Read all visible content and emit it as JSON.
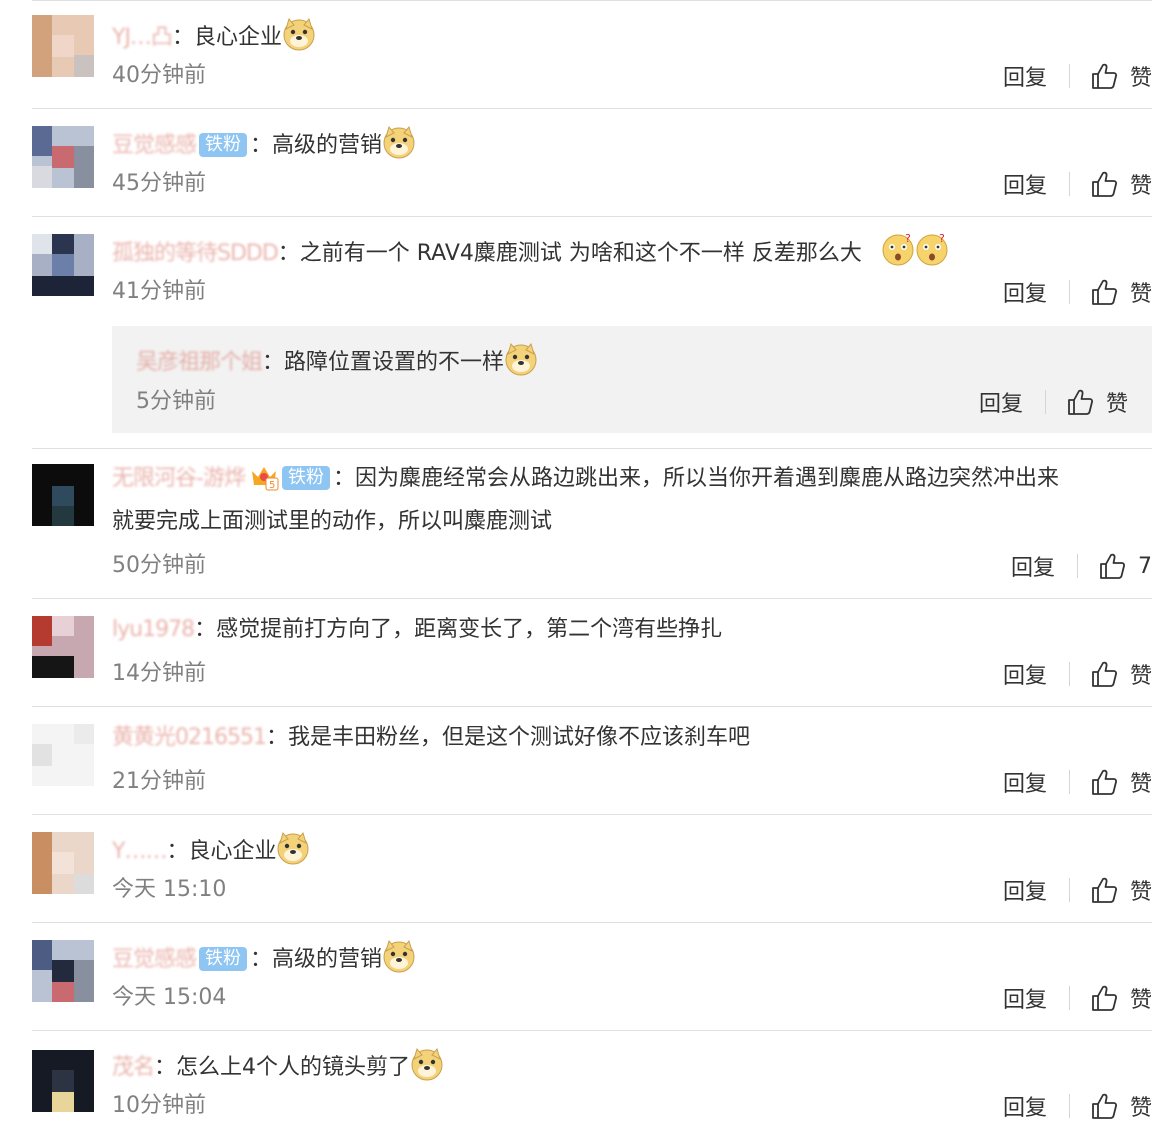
{
  "labels": {
    "reply": "回复",
    "like": "赞",
    "tie_fan": "铁粉"
  },
  "comments": [
    {
      "user": "YJ…凸",
      "text": "：良心企业",
      "time": "40分钟前",
      "likes": "赞"
    },
    {
      "user": "豆觉感感",
      "badge": "铁粉",
      "text": "：高级的营销",
      "time": "45分钟前",
      "likes": "赞"
    },
    {
      "user": "孤独的等待SDDD",
      "text": "：之前有一个 RAV4麋鹿测试  为啥和这个不一样 反差那么大",
      "time": "41分钟前",
      "likes": "赞"
    },
    {
      "user": "吴彦祖那个姐",
      "text": "：路障位置设置的不一样",
      "time": "5分钟前",
      "likes": "赞"
    },
    {
      "user": "无限河谷-游烨",
      "badge": "铁粉",
      "text": "：因为麋鹿经常会从路边跳出来，所以当你开着遇到麋鹿从路边突然冲出来",
      "text2": "就要完成上面测试里的动作，所以叫麋鹿测试",
      "time": "50分钟前",
      "likes": "7"
    },
    {
      "user": "lyu1978",
      "text": "：感觉提前打方向了，距离变长了，第二个湾有些挣扎",
      "time": "14分钟前",
      "likes": "赞"
    },
    {
      "user": "黄黄光0216551",
      "text": "：我是丰田粉丝，但是这个测试好像不应该刹车吧",
      "time": "21分钟前",
      "likes": "赞"
    },
    {
      "user": "Y……",
      "text": "：良心企业",
      "time": "今天 15:10",
      "likes": "赞"
    },
    {
      "user": "豆觉感感",
      "badge": "铁粉",
      "text": "：高级的营销",
      "time": "今天 15:04",
      "likes": "赞"
    },
    {
      "user": "茂名",
      "text": "：怎么上4个人的镜头剪了",
      "time": "10分钟前",
      "likes": "赞"
    }
  ],
  "colors": {
    "username": "#d9776a",
    "badge": "#8ec5f2",
    "time": "#808080",
    "divider": "#e0e0e0",
    "reply_bg": "#f2f2f2"
  }
}
